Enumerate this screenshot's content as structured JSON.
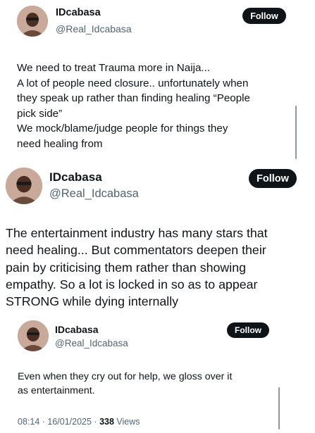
{
  "tweets": [
    {
      "author_name": "IDcabasa",
      "author_handle": "@Real_Idcabasa",
      "follow_label": "Follow",
      "lines": [
        "We need to treat Trauma more in Naija...",
        "A lot of people need closure.. unfortunately when",
        "they speak up rather than finding healing “People",
        "pick side”",
        "We mock/blame/judge people for things they",
        "need healing from"
      ]
    },
    {
      "author_name": "IDcabasa",
      "author_handle": "@Real_Idcabasa",
      "follow_label": "Follow",
      "lines": [
        "The entertainment industry has many stars that",
        "need healing... But commentators deepen their",
        "pain by criticising them rather than showing",
        "empathy. So a lot is locked in so as to appear",
        "STRONG while dying internally"
      ]
    },
    {
      "author_name": "IDcabasa",
      "author_handle": "@Real_Idcabasa",
      "follow_label": "Follow",
      "lines": [
        "Even when they cry out for help, we gloss over it",
        "as entertainment."
      ],
      "timestamp": "08:14 · 16/01/2025 ·",
      "views_count": "338",
      "views_label": "Views"
    }
  ]
}
